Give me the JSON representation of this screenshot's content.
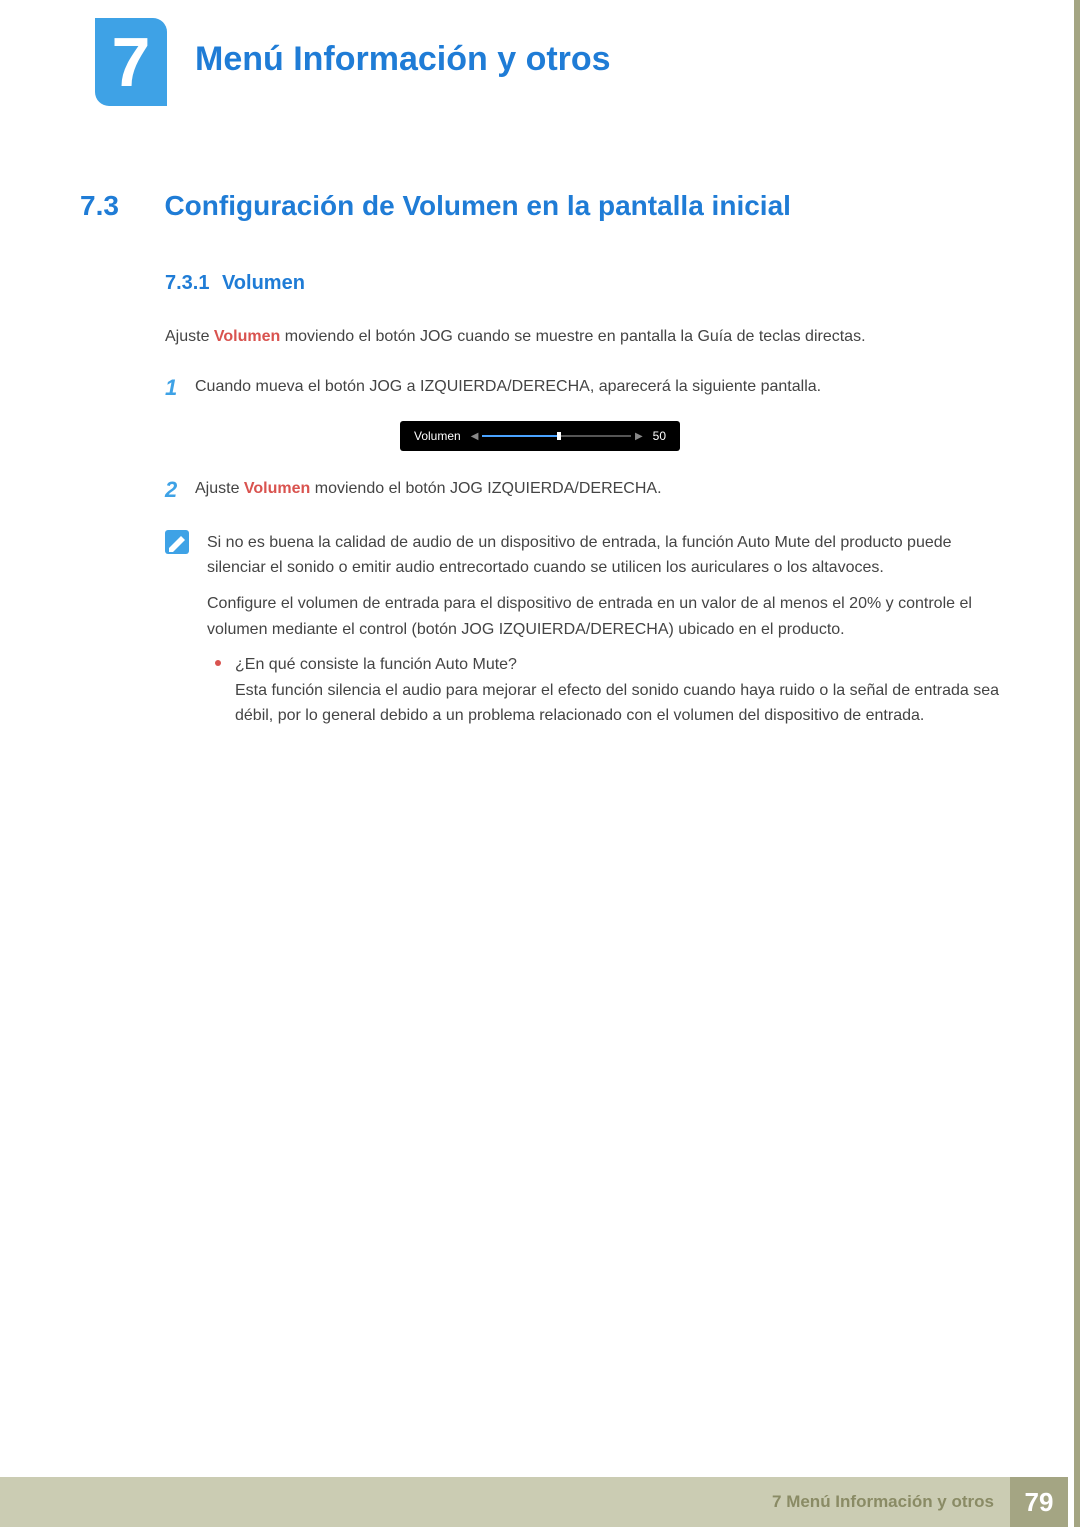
{
  "chapter": {
    "number": "7",
    "title": "Menú Información y otros"
  },
  "section": {
    "number": "7.3",
    "title": "Configuración de Volumen en la pantalla inicial"
  },
  "subsection": {
    "number": "7.3.1",
    "title": "Volumen"
  },
  "intro": {
    "prefix": "Ajuste ",
    "emph": "Volumen",
    "suffix": " moviendo el botón JOG cuando se muestre en pantalla la Guía de teclas directas."
  },
  "steps": {
    "s1": {
      "n": "1",
      "text": "Cuando mueva el botón JOG a IZQUIERDA/DERECHA, aparecerá la siguiente pantalla."
    },
    "s2": {
      "n": "2",
      "prefix": "Ajuste ",
      "emph": "Volumen",
      "suffix": " moviendo el botón JOG IZQUIERDA/DERECHA."
    }
  },
  "osd": {
    "label": "Volumen",
    "value": "50"
  },
  "note": {
    "p1": "Si no es buena la calidad de audio de un dispositivo de entrada, la función Auto Mute del producto puede silenciar el sonido o emitir audio entrecortado cuando se utilicen los auriculares o los altavoces.",
    "p2": "Configure el volumen de entrada para el dispositivo de entrada en un valor de al menos el 20% y controle el volumen mediante el control (botón JOG IZQUIERDA/DERECHA) ubicado en el producto.",
    "bullet_q": "¿En qué consiste la función Auto Mute?",
    "bullet_a": "Esta función silencia el audio para mejorar el efecto del sonido cuando haya ruido o la señal de entrada sea débil, por lo general debido a un problema relacionado con el volumen del dispositivo de entrada."
  },
  "footer": {
    "title": "7 Menú Información y otros",
    "page": "79"
  }
}
